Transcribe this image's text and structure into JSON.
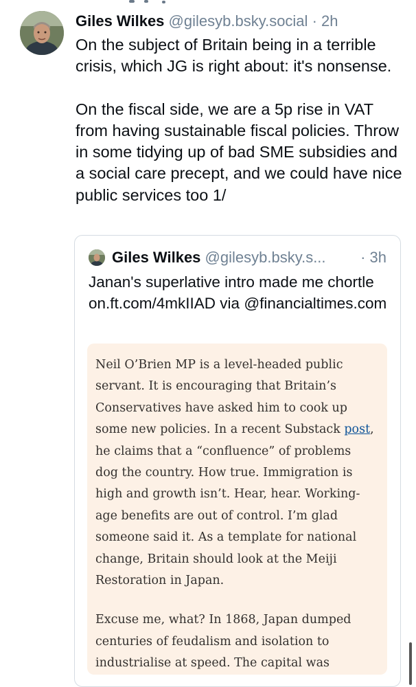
{
  "post": {
    "author": "Giles Wilkes",
    "handle": "@gilesyb.bsky.social",
    "separator": "·",
    "time": "2h",
    "paragraph1": "On the subject of Britain being in a terrible crisis, which JG is right about: it's nonsense.",
    "paragraph2": "On the fiscal side, we are a 5p rise in VAT from having sustainable fiscal policies. Throw in some tidying up of bad SME subsidies and a social care precept, and we could have nice public services too 1/"
  },
  "quote": {
    "author": "Giles Wilkes",
    "handle": "@gilesyb.bsky.s...",
    "time": "· 3h",
    "text": "Janan's superlative intro made me chortle on.ft.com/4mkIIAD via @financialtimes.com",
    "clipping": {
      "p1_before": "Neil O’Brien MP is a level-headed public servant. It is encouraging that Britain’s Conservatives have asked him to cook up some new policies. In a recent Substack ",
      "p1_link": "post",
      "p1_after": ", he claims that a “confluence” of problems dog the country. How true. Immigration is high and growth isn’t. Hear, hear. Working-age benefits are out of control. I’m glad someone said it. As a template for national change, Britain should look at the Meiji Restoration in Japan.",
      "p2": "Excuse me, what? In 1868, Japan dumped centuries of feudalism and isolation to industrialise at speed. The capital was"
    }
  },
  "colors": {
    "text": "#0b0f14",
    "muted": "#6f8193",
    "clip_background": "#fdf1e6",
    "link": "#0f5499"
  },
  "icons": {
    "avatar": "avatar-photo",
    "quote_avatar": "avatar-photo"
  }
}
